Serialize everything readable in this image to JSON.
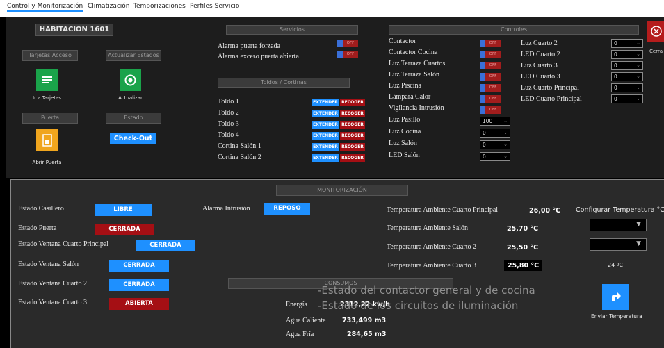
{
  "tabs": [
    "Control y Monitorización",
    "Climatización",
    "Temporizaciones",
    "Perfiles Servicio"
  ],
  "room": {
    "title": "HABITACION 1601"
  },
  "left": {
    "tarjetas_header": "Tarjetas Acceso",
    "actualizar_header": "Actualizar Estados",
    "ir_tarjetas": "Ir a Tarjetas",
    "actualizar": "Actualizar",
    "puerta_header": "Puerta",
    "estado_header": "Estado",
    "checkout": "Check-Out",
    "abrir_puerta": "Abrir Puerta"
  },
  "servicios": {
    "header": "Servicios",
    "items": [
      {
        "label": "Alarma puerta forzada",
        "state": "OFF"
      },
      {
        "label": "Alarma exceso puerta abierta",
        "state": "OFF"
      }
    ]
  },
  "toldos": {
    "header": "Toldos / Cortinas",
    "extend": "EXTENDER",
    "recoger": "RECOGER",
    "items": [
      "Toldo 1",
      "Toldo 2",
      "Toldo 3",
      "Toldo 4",
      "Cortina Salón 1",
      "Cortina Salón 2"
    ]
  },
  "controles": {
    "header": "Controles",
    "toggles": [
      {
        "label": "Contactor",
        "state": "OFF"
      },
      {
        "label": "Contactor Cocina",
        "state": "OFF"
      },
      {
        "label": "Luz Terraza Cuartos",
        "state": "OFF"
      },
      {
        "label": "Luz Terraza Salón",
        "state": "OFF"
      },
      {
        "label": "Luz Piscina",
        "state": "OFF"
      },
      {
        "label": "Lámpara Calor",
        "state": "OFF"
      },
      {
        "label": "Vigilancia Intrusión",
        "state": "OFF"
      }
    ],
    "dimmers_left": [
      {
        "label": "Luz Pasillo",
        "value": "100"
      },
      {
        "label": "Luz Cocina",
        "value": "0"
      },
      {
        "label": "Luz Salón",
        "value": "0"
      },
      {
        "label": "LED Salón",
        "value": "0"
      }
    ],
    "dimmers_right": [
      {
        "label": "Luz Cuarto 2",
        "value": "0"
      },
      {
        "label": "LED Cuarto 2",
        "value": "0"
      },
      {
        "label": "Luz Cuarto 3",
        "value": "0"
      },
      {
        "label": "LED Cuarto 3",
        "value": "0"
      },
      {
        "label": "Luz Cuarto Principal",
        "value": "0"
      },
      {
        "label": "LED Cuarto Principal",
        "value": "0"
      }
    ],
    "close_label": "Cerra"
  },
  "monitor": {
    "header": "MONITORIZACIÓN",
    "estados": [
      {
        "label": "Estado Casillero",
        "value": "LIBRE",
        "color": "#1e90ff"
      },
      {
        "label": "Estado Puerta",
        "value": "CERRADA",
        "color": "#a50f14"
      },
      {
        "label": "Estado Ventana Cuarto Principal",
        "value": "CERRADA",
        "color": "#1e90ff"
      },
      {
        "label": "Estado Ventana Salón",
        "value": "CERRADA",
        "color": "#1e90ff"
      },
      {
        "label": "Estado Ventana Cuarto 2",
        "value": "CERRADA",
        "color": "#1e90ff"
      },
      {
        "label": "Estado Ventana Cuarto 3",
        "value": "ABIERTA",
        "color": "#a50f14"
      }
    ],
    "alarma_label": "Alarma Intrusión",
    "alarma_value": "REPOSO",
    "temps": [
      {
        "label": "Temperatura Ambiente Cuarto Principal",
        "value": "26,00 °C"
      },
      {
        "label": "Temperatura Ambiente Salón",
        "value": "25,70 °C"
      },
      {
        "label": "Temperatura Ambiente Cuarto 2",
        "value": "25,50 °C"
      },
      {
        "label": "Temperatura Ambiente Cuarto 3",
        "value": "25,80 °C"
      }
    ],
    "config_temp_label": "Configurar Temperatura °C",
    "temp_set": "24 ºC",
    "enviar_label": "Enviar Temperatura"
  },
  "consumos": {
    "header": "CONSUMOS",
    "rows": [
      {
        "label": "Energía",
        "value": "2312,22 kw/h"
      },
      {
        "label": "Agua Caliente",
        "value": "733,499  m3"
      },
      {
        "label": "Agua Fría",
        "value": "284,65  m3"
      }
    ]
  },
  "overlay": [
    "-Estado del contactor general y de cocina",
    "-Estado de los circuitos de iluminación"
  ],
  "colors": {
    "blue": "#1e90ff",
    "red": "#a50f14",
    "green": "#1aa34a",
    "orange": "#f0a51e"
  }
}
